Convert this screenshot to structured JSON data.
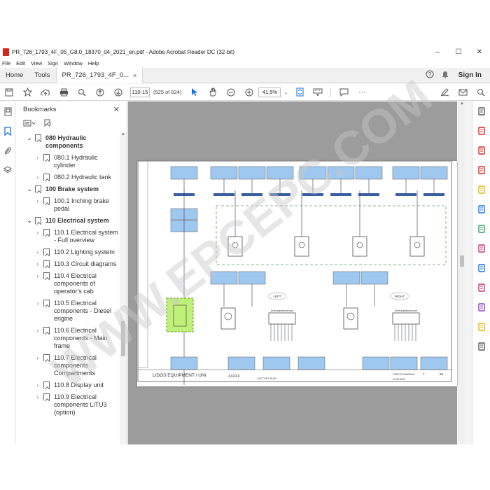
{
  "window": {
    "title": "PR_726_1793_4F_05_G8.0_18370_04_2021_en.pdf - Adobe Acrobat Reader DC (32-bit)",
    "minimize": "–",
    "maximize": "☐",
    "close": "✕"
  },
  "menu": [
    "File",
    "Edit",
    "View",
    "Sign",
    "Window",
    "Help"
  ],
  "tabs": {
    "home": "Home",
    "tools": "Tools",
    "document": "PR_726_1793_4F_0...",
    "close": "×"
  },
  "header": {
    "help_icon": "?",
    "bell_icon": "🔔",
    "sign_in": "Sign In"
  },
  "toolbar": {
    "page_field": "110-15",
    "page_count": "(525 of 824)",
    "zoom": "41,5%"
  },
  "bookmarks": {
    "title": "Bookmarks",
    "close": "✕",
    "items": [
      {
        "level": 0,
        "arrow": "⌄",
        "label": "080 Hydraulic components"
      },
      {
        "level": 1,
        "arrow": "›",
        "label": "080.1 Hydraulic cylinder"
      },
      {
        "level": 1,
        "arrow": "›",
        "label": "080.2 Hydraulic tank"
      },
      {
        "level": 0,
        "arrow": "⌄",
        "label": "100 Brake system"
      },
      {
        "level": 1,
        "arrow": "›",
        "label": "100.1 Inching brake pedal"
      },
      {
        "level": 0,
        "arrow": "⌄",
        "label": "110 Electrical system"
      },
      {
        "level": 1,
        "arrow": "›",
        "label": "110.1 Electrical system - Full overview"
      },
      {
        "level": 1,
        "arrow": "›",
        "label": "110.2 Lighting system"
      },
      {
        "level": 1,
        "arrow": "›",
        "label": "110.3 Circuit diagrams"
      },
      {
        "level": 1,
        "arrow": "›",
        "label": "110.4 Electrical components of operator's cab"
      },
      {
        "level": 1,
        "arrow": "›",
        "label": "110.5 Electrical components - Diesel engine"
      },
      {
        "level": 1,
        "arrow": "›",
        "label": "110.6 Electrical components - Main frame"
      },
      {
        "level": 1,
        "arrow": "›",
        "label": "110.7 Electrical components Compartments"
      },
      {
        "level": 1,
        "arrow": "›",
        "label": "110.8 Display unit"
      },
      {
        "level": 1,
        "arrow": "›",
        "label": "110.9 Electrical components LiTU3 (option)"
      }
    ]
  },
  "drawing": {
    "company": "LIDOS EQUIPMENT / UNI",
    "drawing_no": "XXXXX",
    "left_label": "LEFT",
    "right_label": "RIGHT",
    "box_label": "Drehzapfensensor",
    "sheet": "7",
    "sheet_total": "56",
    "date": "01.05.2020",
    "circuit_title": "CIRCUIT DIAGRAM",
    "factory_test": "FACTORY TEUR"
  },
  "watermark": "WWW.EPCEPC.COM",
  "colors": {
    "accent": "#1473e6",
    "pdf_red": "#d5261d",
    "connector_blue": "#9fc8f0",
    "highlight_green": "#bff07a",
    "dash_green": "#5fa85f"
  }
}
